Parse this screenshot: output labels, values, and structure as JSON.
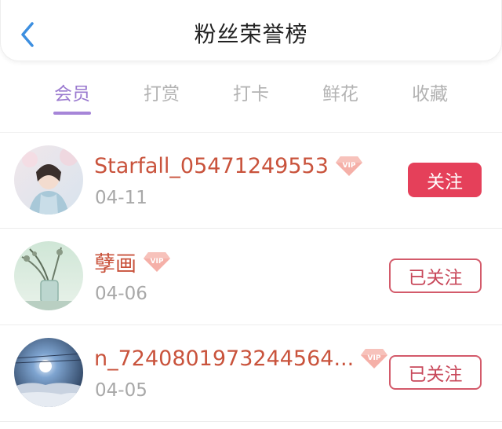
{
  "header": {
    "title": "粉丝荣誉榜"
  },
  "tabs": [
    {
      "label": "会员",
      "active": true
    },
    {
      "label": "打赏",
      "active": false
    },
    {
      "label": "打卡",
      "active": false
    },
    {
      "label": "鲜花",
      "active": false
    },
    {
      "label": "收藏",
      "active": false
    }
  ],
  "fans": [
    {
      "name": "Starfall_05471249553",
      "date": "04-11",
      "badge": "VIP",
      "action": "关注"
    },
    {
      "name": "孽画",
      "date": "04-06",
      "badge": "VIP",
      "action": "已关注"
    },
    {
      "name": "n_7240801973244564...",
      "date": "04-05",
      "badge": "VIP",
      "action": "已关注"
    }
  ],
  "colors": {
    "accent_purple": "#9a79cf",
    "name_color": "#c9533c",
    "follow_button": "#e5405a",
    "back_arrow": "#3d8fe0"
  },
  "icons": {
    "back": "chevron-left-icon",
    "vip": "vip-diamond-icon"
  }
}
